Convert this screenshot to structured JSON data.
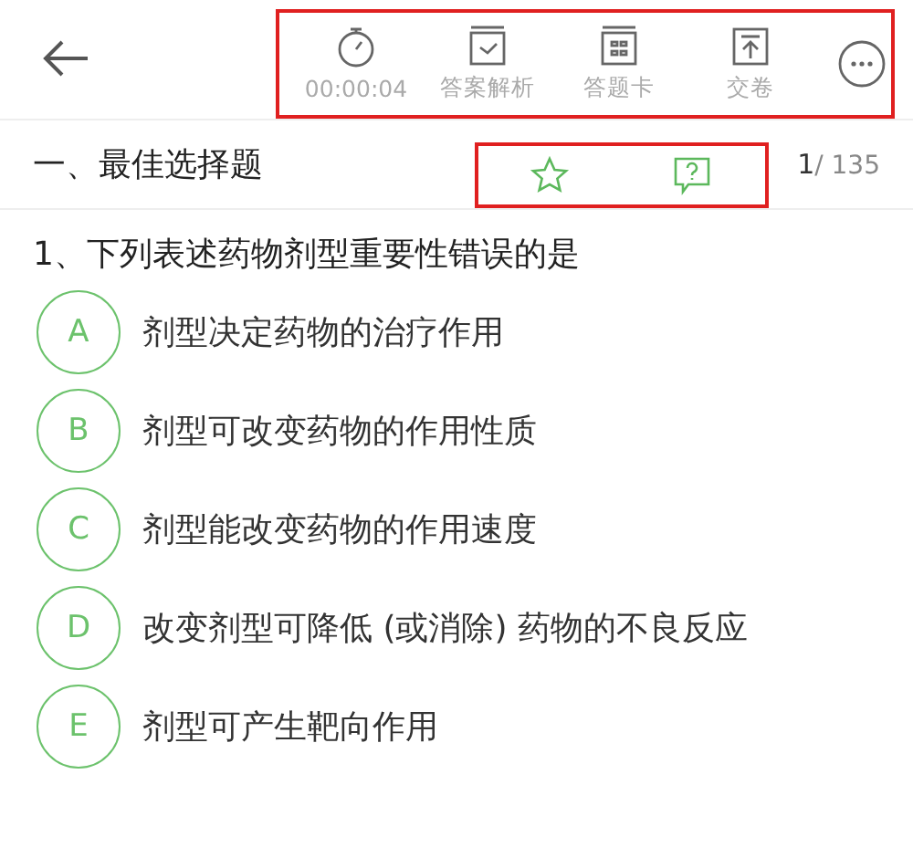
{
  "toolbar": {
    "items": [
      {
        "kind": "timer",
        "label": "00:00:04"
      },
      {
        "kind": "answer",
        "label": "答案解析"
      },
      {
        "kind": "card",
        "label": "答题卡"
      },
      {
        "kind": "submit",
        "label": "交卷"
      },
      {
        "kind": "more"
      }
    ]
  },
  "section": {
    "title": "一、最佳选择题",
    "current": "1",
    "total": "/ 135"
  },
  "question": {
    "text": "1、下列表述药物剂型重要性错误的是",
    "options": [
      {
        "letter": "A",
        "text": "剂型决定药物的治疗作用"
      },
      {
        "letter": "B",
        "text": "剂型可改变药物的作用性质"
      },
      {
        "letter": "C",
        "text": "剂型能改变药物的作用速度"
      },
      {
        "letter": "D",
        "text": "改变剂型可降低 (或消除) 药物的不良反应"
      },
      {
        "letter": "E",
        "text": "剂型可产生靶向作用"
      }
    ]
  }
}
